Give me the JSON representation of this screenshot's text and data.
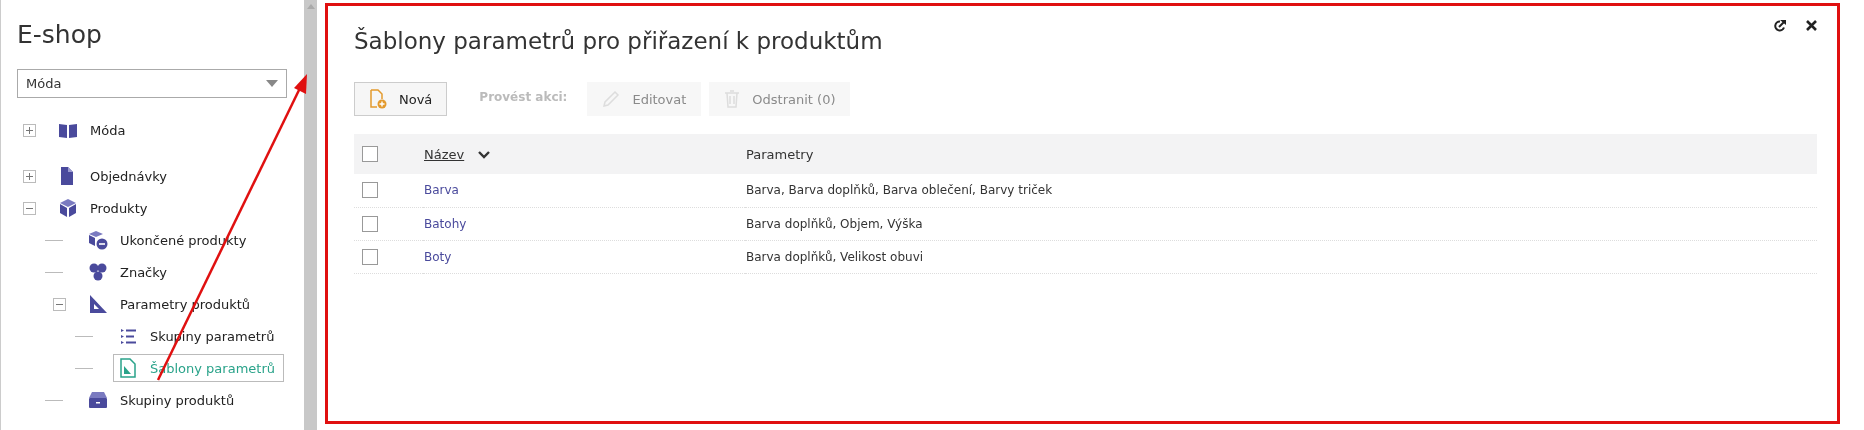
{
  "sidebar": {
    "title": "E-shop",
    "dropdown": {
      "value": "Móda"
    },
    "tree": [
      {
        "items": [
          {
            "label": "Móda",
            "kind": "book",
            "expanded": false,
            "selected": false
          }
        ]
      },
      {
        "items": [
          {
            "label": "Objednávky",
            "kind": "document",
            "expanded": false,
            "selected": false
          },
          {
            "label": "Produkty",
            "kind": "cube",
            "expanded": true,
            "selected": false,
            "children": [
              {
                "label": "Ukončené produkty",
                "kind": "cube-minus",
                "selected": false
              },
              {
                "label": "Značky",
                "kind": "circles",
                "selected": false
              },
              {
                "label": "Parametry produktů",
                "kind": "triangle",
                "expanded": true,
                "selected": false,
                "children": [
                  {
                    "label": "Skupiny parametrů",
                    "kind": "list",
                    "selected": false
                  },
                  {
                    "label": "Šablony parametrů",
                    "kind": "template",
                    "selected": true
                  }
                ]
              },
              {
                "label": "Skupiny produktů",
                "kind": "drawer",
                "selected": false
              }
            ]
          }
        ]
      }
    ]
  },
  "main": {
    "title": "Šablony parametrů pro přiřazení k produktům",
    "toolbar": {
      "new_button": {
        "label": "Nová",
        "disabled": false
      },
      "actions_label": "Provést akci:",
      "actions": [
        {
          "label": "Editovat",
          "kind": "pencil",
          "disabled": true
        },
        {
          "label": "Odstranit (0)",
          "kind": "trash",
          "disabled": true
        }
      ]
    },
    "table": {
      "header_checked": false,
      "columns": [
        "Název",
        "Parametry"
      ],
      "rows": [
        {
          "checked": false,
          "name": "Barva",
          "parameters": "Barva, Barva doplňků, Barva oblečení, Barvy triček"
        },
        {
          "checked": false,
          "name": "Batohy",
          "parameters": "Barva doplňků, Objem, Výška"
        },
        {
          "checked": false,
          "name": "Boty",
          "parameters": "Barva doplňků, Velikost obuvi"
        }
      ]
    }
  }
}
